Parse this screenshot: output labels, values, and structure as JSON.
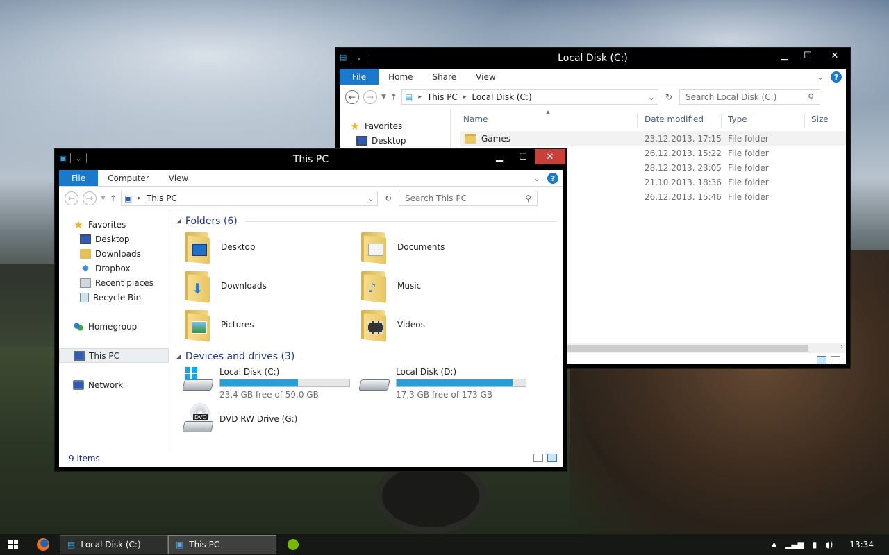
{
  "desktop": {
    "taskbar": {
      "apps": [
        {
          "label": "Local Disk (C:)"
        },
        {
          "label": "This PC"
        }
      ],
      "clock": "13:34",
      "tray_up": "▲"
    }
  },
  "win_c": {
    "title": "Local Disk (C:)",
    "tabs": {
      "file": "File",
      "home": "Home",
      "share": "Share",
      "view": "View"
    },
    "address": {
      "root": "This PC",
      "current": "Local Disk (C:)"
    },
    "search_placeholder": "Search Local Disk (C:)",
    "sidebar": {
      "favorites": "Favorites",
      "desktop": "Desktop"
    },
    "columns": {
      "name": "Name",
      "date": "Date modified",
      "type": "Type",
      "size": "Size"
    },
    "rows": [
      {
        "name": "Games",
        "date": "23.12.2013. 17:15",
        "type": "File folder"
      },
      {
        "name": "",
        "date": "26.12.2013. 15:22",
        "type": "File folder"
      },
      {
        "name": "",
        "date": "28.12.2013. 23:05",
        "type": "File folder"
      },
      {
        "name": "",
        "date": "21.10.2013. 18:36",
        "type": "File folder"
      },
      {
        "name": "",
        "date": "26.12.2013. 15:46",
        "type": "File folder"
      }
    ]
  },
  "win_pc": {
    "title": "This PC",
    "tabs": {
      "file": "File",
      "computer": "Computer",
      "view": "View"
    },
    "address": {
      "current": "This PC"
    },
    "search_placeholder": "Search This PC",
    "sidebar": {
      "favorites": "Favorites",
      "items": [
        "Desktop",
        "Downloads",
        "Dropbox",
        "Recent places",
        "Recycle Bin"
      ],
      "homegroup": "Homegroup",
      "thispc": "This PC",
      "network": "Network"
    },
    "folders_heading": "Folders (6)",
    "folders": [
      "Desktop",
      "Documents",
      "Downloads",
      "Music",
      "Pictures",
      "Videos"
    ],
    "devices_heading": "Devices and drives (3)",
    "drives": [
      {
        "name": "Local Disk (C:)",
        "free": "23,4 GB free of 59,0 GB",
        "used_fraction": 0.6
      },
      {
        "name": "Local Disk (D:)",
        "free": "17,3 GB free of 173 GB",
        "used_fraction": 0.9
      },
      {
        "name": "DVD RW Drive (G:)"
      }
    ],
    "dvd_badge": "DVD",
    "status": "9 items"
  },
  "colors": {
    "accent": "#1979ca",
    "bar_fill": "#26a0da",
    "heading": "#1e3287"
  }
}
